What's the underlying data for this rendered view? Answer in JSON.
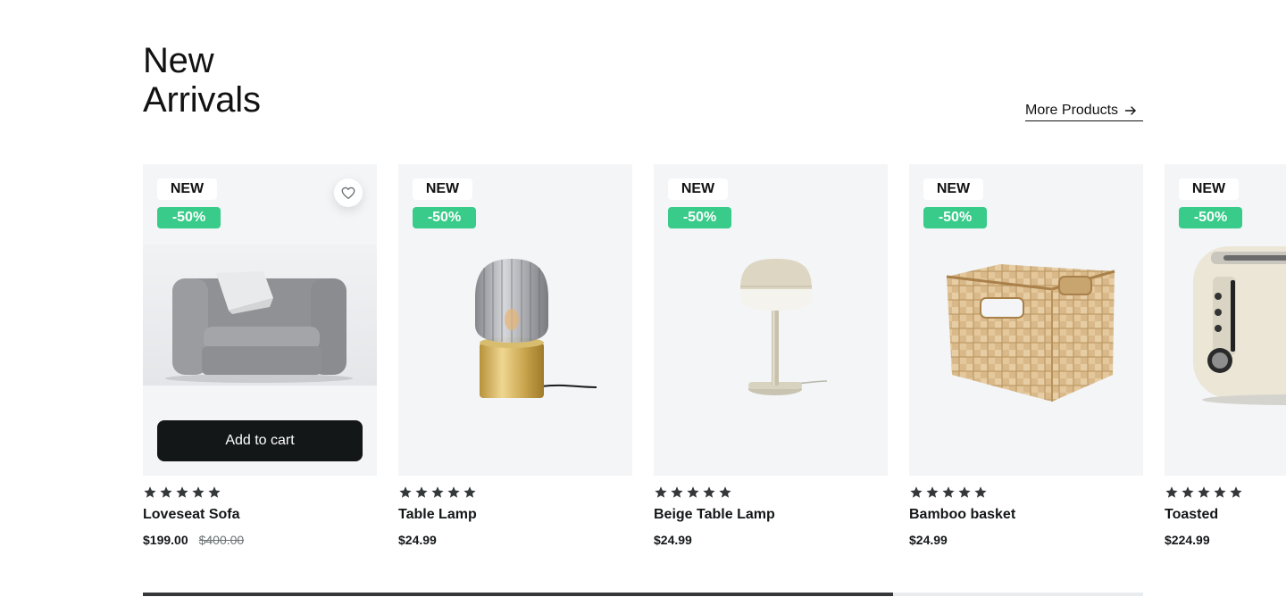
{
  "section": {
    "title_line1": "New",
    "title_line2": "Arrivals",
    "more_label": "More Products"
  },
  "colors": {
    "discount_badge": "#38cb89",
    "card_background": "#f3f5f7",
    "button_dark": "#141718",
    "star": "#343839"
  },
  "products": [
    {
      "badge_new": "NEW",
      "badge_discount": "-50%",
      "rating": 5,
      "name": "Loveseat Sofa",
      "price": "$199.00",
      "old_price": "$400.00",
      "add_to_cart": "Add to cart",
      "icon": "wishlist-heart-icon"
    },
    {
      "badge_new": "NEW",
      "badge_discount": "-50%",
      "rating": 5,
      "name": "Table Lamp",
      "price": "$24.99"
    },
    {
      "badge_new": "NEW",
      "badge_discount": "-50%",
      "rating": 5,
      "name": "Beige Table Lamp",
      "price": "$24.99"
    },
    {
      "badge_new": "NEW",
      "badge_discount": "-50%",
      "rating": 5,
      "name": "Bamboo basket",
      "price": "$24.99"
    },
    {
      "badge_new": "NEW",
      "badge_discount": "-50%",
      "rating": 5,
      "name": "Toasted",
      "price": "$224.99"
    }
  ],
  "carousel": {
    "scroll_progress": 0.75
  }
}
